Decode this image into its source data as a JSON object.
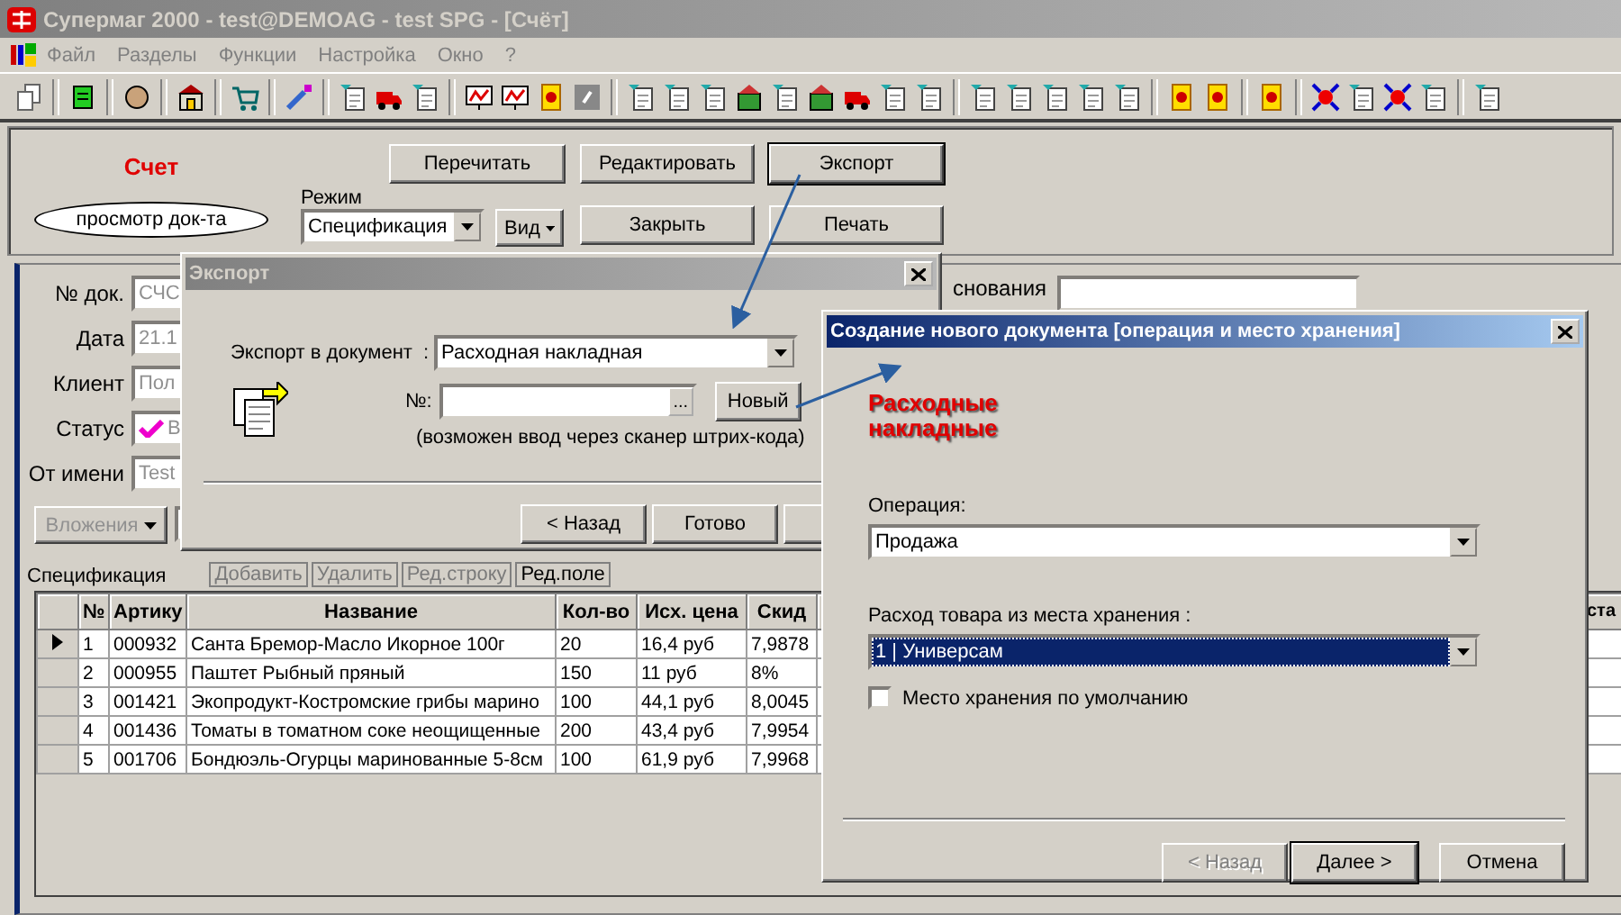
{
  "window": {
    "title": "Супермаг 2000 - test@DEMOAG - test SPG - [Счёт]",
    "active": false
  },
  "menu": [
    {
      "label": "Файл"
    },
    {
      "label": "Разделы"
    },
    {
      "label": "Функции"
    },
    {
      "label": "Настройка"
    },
    {
      "label": "Окно"
    },
    {
      "label": "?"
    }
  ],
  "document": {
    "title": "Счет",
    "mode_badge": "просмотр док-та",
    "mode_label": "Режим",
    "mode_value": "Спецификация",
    "view_button": "Вид",
    "buttons": [
      {
        "label": "Перечитать"
      },
      {
        "label": "Редактировать"
      },
      {
        "label": "Экспорт"
      },
      {
        "label": "Закрыть"
      },
      {
        "label": "Печать"
      }
    ]
  },
  "form": {
    "fields": [
      {
        "label": "№ док.",
        "value": "СЧС",
        "kind": "text"
      },
      {
        "label": "Дата",
        "value": "21.1",
        "kind": "text"
      },
      {
        "label": "Клиент",
        "value": "Пол",
        "kind": "text"
      },
      {
        "label": "Статус",
        "value": "В",
        "kind": "status"
      },
      {
        "label": "От имени",
        "value": "Test",
        "kind": "text"
      }
    ],
    "basis_label": "снования",
    "attachments_button": "Вложения"
  },
  "specification": {
    "label": "Спецификация",
    "actions": [
      {
        "label": "Добавить",
        "disabled": true
      },
      {
        "label": "Удалить",
        "disabled": true
      },
      {
        "label": "Ред.строку",
        "disabled": true
      },
      {
        "label": "Ред.поле",
        "disabled": false
      }
    ],
    "columns": [
      "№",
      "Артику",
      "Название",
      "Кол-во",
      "Исх. цена",
      "Скид"
    ],
    "right_column_header": "ста",
    "rows": [
      {
        "selected": true,
        "cells": [
          "1",
          "000932",
          "Санта Бремор-Масло Икорное 100г",
          "20",
          "16,4 руб",
          "7,9878"
        ]
      },
      {
        "selected": false,
        "cells": [
          "2",
          "000955",
          "Паштет Рыбный пряный",
          "150",
          "11 руб",
          "8%"
        ]
      },
      {
        "selected": false,
        "cells": [
          "3",
          "001421",
          "Экопродукт-Костромские грибы марино",
          "100",
          "44,1 руб",
          "8,0045"
        ]
      },
      {
        "selected": false,
        "cells": [
          "4",
          "001436",
          "Томаты в томатном соке неощищенные",
          "200",
          "43,4 руб",
          "7,9954"
        ]
      },
      {
        "selected": false,
        "cells": [
          "5",
          "001706",
          "Бондюэль-Огурцы маринованные 5-8см",
          "100",
          "61,9 руб",
          "7,9968"
        ]
      }
    ]
  },
  "export_dialog": {
    "title": "Экспорт",
    "active": false,
    "target_label": "Экспорт в документ  :",
    "target_value": "Расходная накладная",
    "number_label": "№:",
    "browse_button": "...",
    "new_button": "Новый",
    "hint": "(возможен ввод через сканер штрих-кода)",
    "buttons": [
      {
        "label": "< Назад"
      },
      {
        "label": "Готово"
      }
    ]
  },
  "new_document_dialog": {
    "title": "Создание нового документа [операция и место хранения]",
    "active": true,
    "heading": "Расходные накладные",
    "operation_label": "Операция:",
    "operation_value": "Продажа",
    "storage_label": "Расход товара из места хранения :",
    "storage_value": "1 | Универсам",
    "storage_highlighted": true,
    "default_checkbox": {
      "label": "Место хранения по умолчанию",
      "checked": false
    },
    "buttons": [
      {
        "label": "< Назад",
        "disabled": true,
        "default": false
      },
      {
        "label": "Далее >",
        "disabled": false,
        "default": true
      },
      {
        "label": "Отмена",
        "disabled": false,
        "default": false
      }
    ]
  }
}
